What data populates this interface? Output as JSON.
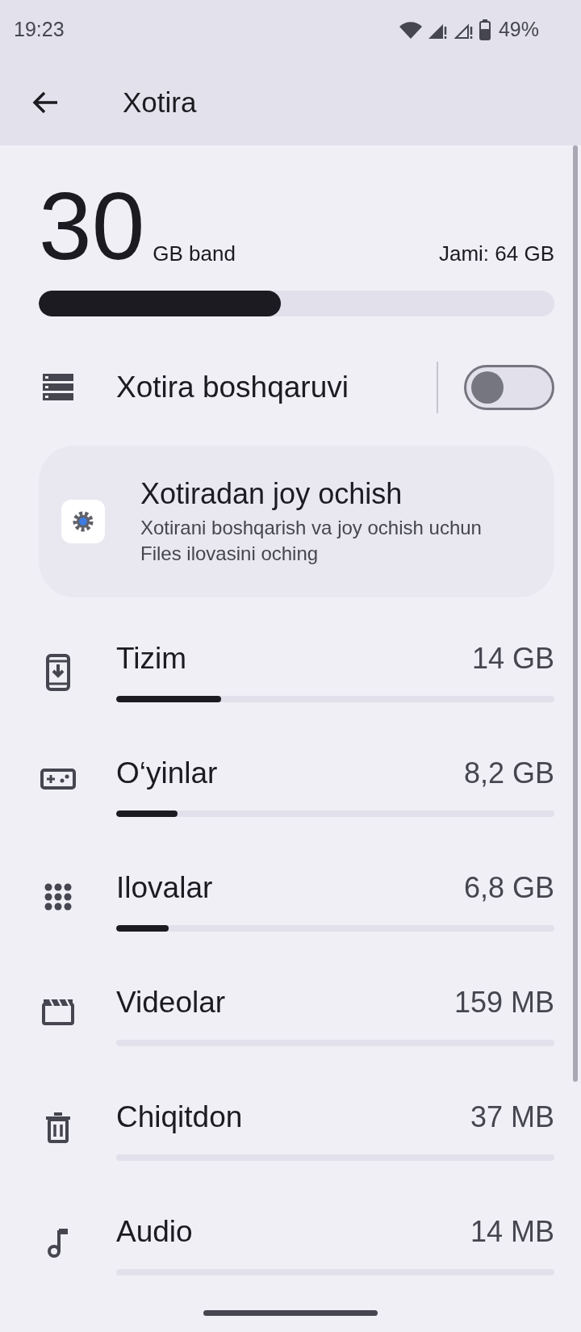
{
  "status_bar": {
    "time": "19:23",
    "battery": "49%"
  },
  "app_bar": {
    "title": "Xotira"
  },
  "summary": {
    "used": "30",
    "used_unit": "GB band",
    "total": "Jami: 64 GB",
    "level": 0.47
  },
  "storage_manager": {
    "label": "Xotira boshqaruvi",
    "on": false
  },
  "card": {
    "title": "Xotiradan joy ochish",
    "text": "Xotirani boshqarish va joy ochish uchun Files ilovasini oching"
  },
  "categories": [
    {
      "kind": "system",
      "name": "Tizim",
      "size": "14 GB",
      "level": 0.24
    },
    {
      "kind": "games",
      "name": "O‘yinlar",
      "size": "8,2 GB",
      "level": 0.14
    },
    {
      "kind": "apps",
      "name": "Ilovalar",
      "size": "6,8 GB",
      "level": 0.12
    },
    {
      "kind": "videos",
      "name": "Videolar",
      "size": "159 MB",
      "level": 0
    },
    {
      "kind": "trash",
      "name": "Chiqitdon",
      "size": "37 MB",
      "level": 0
    },
    {
      "kind": "audio",
      "name": "Audio",
      "size": "14 MB",
      "level": 0
    }
  ]
}
